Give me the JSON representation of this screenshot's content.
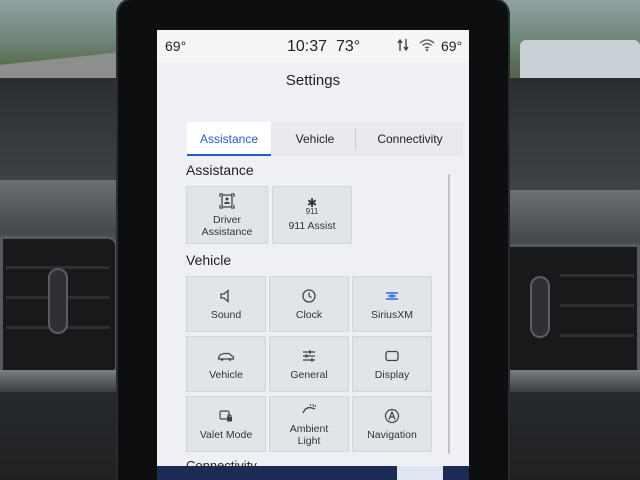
{
  "status_bar": {
    "outside_temp_left": "69°",
    "time": "10:37",
    "cabin_temp": "73°",
    "outside_temp_right": "69°",
    "icons": [
      "phone-signal-icon",
      "wifi-icon"
    ]
  },
  "header": {
    "title": "Settings"
  },
  "tabs": [
    {
      "label": "Assistance",
      "active": true
    },
    {
      "label": "Vehicle",
      "active": false
    },
    {
      "label": "Connectivity",
      "active": false
    }
  ],
  "sections": {
    "assistance": {
      "title": "Assistance",
      "items": [
        {
          "label": "Driver Assistance",
          "icon": "driver-assist-icon"
        },
        {
          "label": "911 Assist",
          "icon": "assist-911-icon",
          "icon_text": "911"
        }
      ]
    },
    "vehicle": {
      "title": "Vehicle",
      "items": [
        {
          "label": "Sound",
          "icon": "speaker-icon"
        },
        {
          "label": "Clock",
          "icon": "clock-icon"
        },
        {
          "label": "SiriusXM",
          "icon": "siriusxm-icon"
        },
        {
          "label": "Vehicle",
          "icon": "car-icon"
        },
        {
          "label": "General",
          "icon": "sliders-icon"
        },
        {
          "label": "Display",
          "icon": "display-icon"
        },
        {
          "label": "Valet Mode",
          "icon": "valet-icon"
        },
        {
          "label": "Ambient Light",
          "icon": "ambient-light-icon"
        },
        {
          "label": "Navigation",
          "icon": "navigation-icon"
        }
      ]
    },
    "connectivity": {
      "title": "Connectivity"
    }
  },
  "colors": {
    "accent": "#1f5fc5",
    "nav_bar": "#1d2a55"
  }
}
